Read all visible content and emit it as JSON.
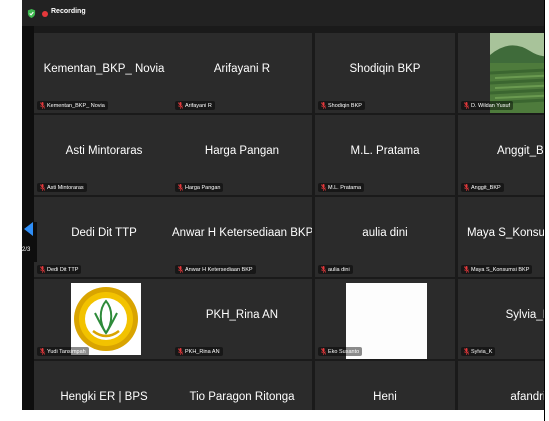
{
  "recording": {
    "label": "Recording"
  },
  "tiles": [
    {
      "name": "Kementan_BKP_ Novia",
      "label": "Kementan_BKP_ Novia"
    },
    {
      "name": "Arifayani R",
      "label": "Arifayani R"
    },
    {
      "name": "Shodiqin BKP",
      "label": "Shodiqin BKP"
    },
    {
      "name": "",
      "label": "D. Wildan Yusuf"
    },
    {
      "name": "Asti Mintoraras",
      "label": "Asti Mintoraras"
    },
    {
      "name": "Harga Pangan",
      "label": "Harga Pangan"
    },
    {
      "name": "M.L. Pratama",
      "label": "M.L. Pratama"
    },
    {
      "name": "Anggit_BKP",
      "label": "Anggit_BKP"
    },
    {
      "name": "Dedi Dit TTP",
      "label": "Dedi Dit TTP"
    },
    {
      "name": "Anwar H Ketersediaan BKP",
      "label": "Anwar H Ketersediaan BKP"
    },
    {
      "name": "aulia dini",
      "label": "aulia dini"
    },
    {
      "name": "Maya S_Konsumsi BKP",
      "label": "Maya S_Konsumsi BKP"
    },
    {
      "name": "",
      "label": "Yudi Tansimpah"
    },
    {
      "name": "PKH_Rina AN",
      "label": "PKH_Rina AN"
    },
    {
      "name": "",
      "label": "Eko Susanto"
    },
    {
      "name": "Sylvia_K",
      "label": "Sylvia_K"
    },
    {
      "name": "Hengki ER | BPS",
      "label": ""
    },
    {
      "name": "Tio Paragon Ritonga",
      "label": ""
    },
    {
      "name": "Heni",
      "label": ""
    },
    {
      "name": "afandri",
      "label": ""
    }
  ],
  "nav": {
    "page": "2/3"
  },
  "colors": {
    "tile_bg": "#2b2b2b",
    "recording": "#e5383b",
    "nav_arrow": "#2e8ef7",
    "mic_muted": "#e5383b"
  }
}
